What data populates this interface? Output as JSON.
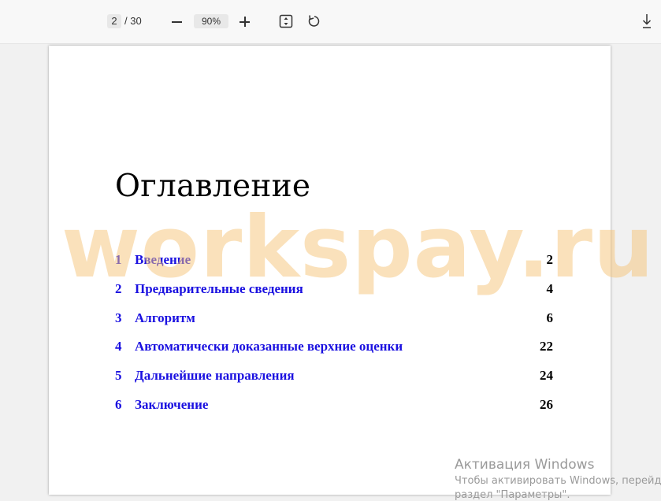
{
  "toolbar": {
    "current_page": "2",
    "total_pages": "/ 30",
    "zoom": "90%"
  },
  "document": {
    "title": "Оглавление",
    "toc": [
      {
        "num": "1",
        "text": "Введение",
        "page": "2"
      },
      {
        "num": "2",
        "text": "Предварительные сведения",
        "page": "4"
      },
      {
        "num": "3",
        "text": "Алгоритм",
        "page": "6"
      },
      {
        "num": "4",
        "text": "Автоматически доказанные верхние оценки",
        "page": "22"
      },
      {
        "num": "5",
        "text": "Дальнейшие направления",
        "page": "24"
      },
      {
        "num": "6",
        "text": "Заключение",
        "page": "26"
      }
    ],
    "link_color": "#1a10e0"
  },
  "watermark": "workspay.ru",
  "activation": {
    "title": "Активация Windows",
    "line1": "Чтобы активировать Windows, перейд",
    "line2": "раздел \"Параметры\"."
  },
  "icons": [
    "zoom-out-icon",
    "zoom-in-icon",
    "fit-page-icon",
    "rotate-icon",
    "download-icon"
  ]
}
